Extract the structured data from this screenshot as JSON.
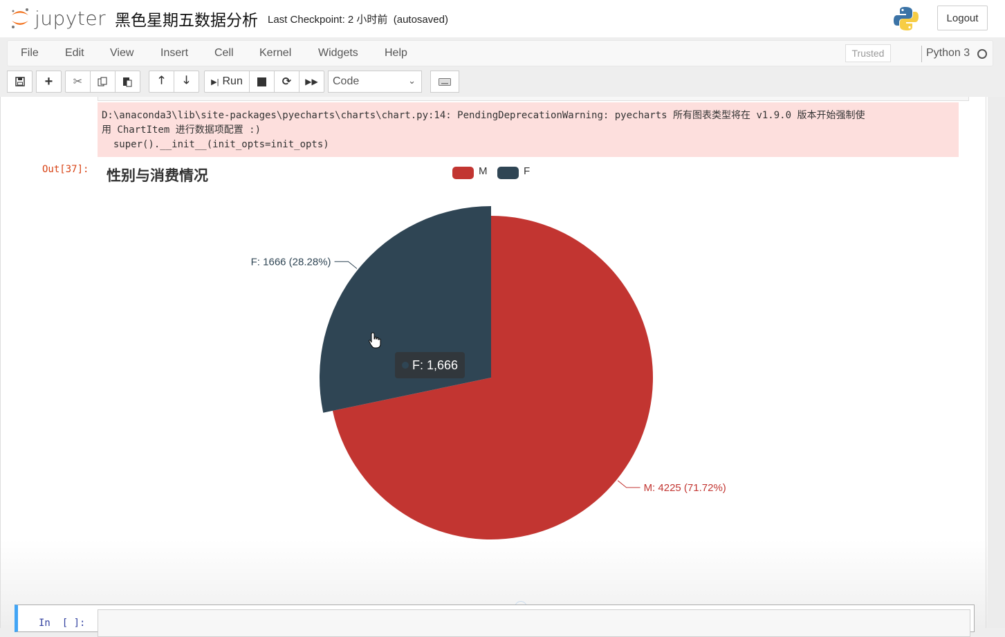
{
  "header": {
    "logo_text": "jupyter",
    "notebook_name": "黑色星期五数据分析",
    "checkpoint": "Last Checkpoint: 2 小时前  (autosaved)",
    "logout_label": "Logout"
  },
  "menubar": {
    "items": [
      "File",
      "Edit",
      "View",
      "Insert",
      "Cell",
      "Kernel",
      "Widgets",
      "Help"
    ],
    "trusted_label": "Trusted",
    "kernel_name": "Python 3"
  },
  "toolbar": {
    "run_label": "Run",
    "cell_type": "Code"
  },
  "output": {
    "stderr_lines": [
      "D:\\anaconda3\\lib\\site-packages\\pyecharts\\charts\\chart.py:14: PendingDeprecationWarning: pyecharts 所有图表类型将在 v1.9.0 版本开始强制使",
      "用 ChartItem 进行数据项配置 :)",
      "  super().__init__(init_opts=init_opts)"
    ],
    "out_prompt": "Out[37]:",
    "tooltip": {
      "text": "F: 1,666",
      "color": "#2f4554"
    }
  },
  "chart_data": {
    "type": "pie",
    "title": "性别与消费情况",
    "legend": [
      "M",
      "F"
    ],
    "legend_position": "top-center",
    "series": [
      {
        "name": "M",
        "value": 4225,
        "percent": 71.72,
        "color": "#c23531",
        "label": "M: 4225 (71.72%)"
      },
      {
        "name": "F",
        "value": 1666,
        "percent": 28.28,
        "color": "#2f4554",
        "label": "F: 1666 (28.28%)",
        "emphasized": true
      }
    ]
  },
  "next_cell": {
    "prompt": "In  [ ]:"
  }
}
